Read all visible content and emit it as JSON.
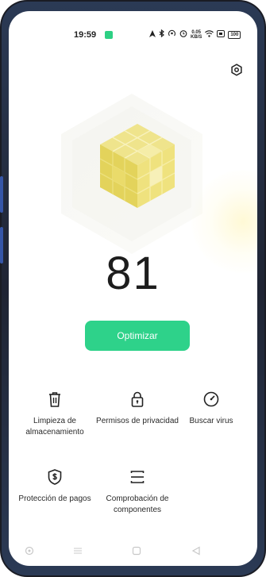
{
  "status_bar": {
    "time": "19:59",
    "network_speed_value": "0.05",
    "network_speed_unit": "KB/S",
    "battery": "100"
  },
  "hero": {
    "score": "81"
  },
  "actions": {
    "optimize_label": "Optimizar"
  },
  "tools": [
    {
      "label": "Limpieza de almacenamiento",
      "icon": "trash-icon"
    },
    {
      "label": "Permisos de privacidad",
      "icon": "lock-icon"
    },
    {
      "label": "Buscar virus",
      "icon": "gauge-icon"
    },
    {
      "label": "Protección de pagos",
      "icon": "dollar-shield-icon"
    },
    {
      "label": "Comprobación de componentes",
      "icon": "components-icon"
    }
  ],
  "nav_bar": [
    "circle-icon",
    "menu-icon",
    "home-square-icon",
    "back-triangle-icon"
  ],
  "colors": {
    "accent": "#2ed28a",
    "cube": "#eadc6a",
    "background": "#ffffff"
  }
}
